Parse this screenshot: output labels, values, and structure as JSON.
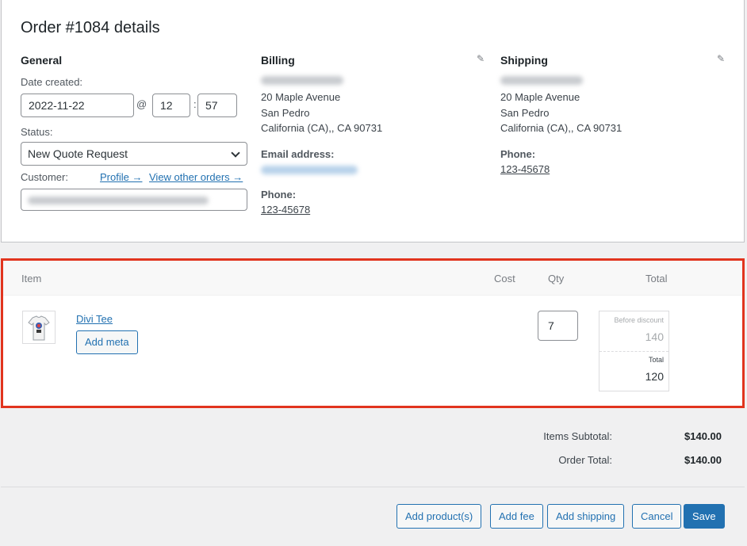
{
  "order_title": "Order #1084 details",
  "general": {
    "heading": "General",
    "date_label": "Date created:",
    "date": "2022-11-22",
    "at": "@",
    "hour": "12",
    "colon": ":",
    "minute": "57",
    "status_label": "Status:",
    "status_value": "New Quote Request",
    "customer_label": "Customer:",
    "profile_link": "Profile →",
    "view_orders_link": "View other orders →"
  },
  "billing": {
    "heading": "Billing",
    "address": [
      "20 Maple Avenue",
      "San Pedro",
      "California (CA),, CA 90731"
    ],
    "email_label": "Email address:",
    "phone_label": "Phone:",
    "phone": "123-45678"
  },
  "shipping": {
    "heading": "Shipping",
    "address": [
      "20 Maple Avenue",
      "San Pedro",
      "California (CA),, CA 90731"
    ],
    "phone_label": "Phone:",
    "phone": "123-45678"
  },
  "items": {
    "headers": {
      "item": "Item",
      "cost": "Cost",
      "qty": "Qty",
      "total": "Total"
    },
    "rows": [
      {
        "name": "Divi Tee",
        "add_meta": "Add meta",
        "qty": "7",
        "before_discount_label": "Before discount",
        "before_discount": "140",
        "total_label": "Total",
        "total": "120"
      }
    ]
  },
  "totals": {
    "subtotal_label": "Items Subtotal:",
    "subtotal": "$140.00",
    "order_total_label": "Order Total:",
    "order_total": "$140.00"
  },
  "actions": {
    "add_products": "Add product(s)",
    "add_fee": "Add fee",
    "add_shipping": "Add shipping",
    "cancel": "Cancel",
    "save": "Save"
  },
  "colors": {
    "accent": "#2271b1",
    "highlight_border": "#e1341e"
  }
}
